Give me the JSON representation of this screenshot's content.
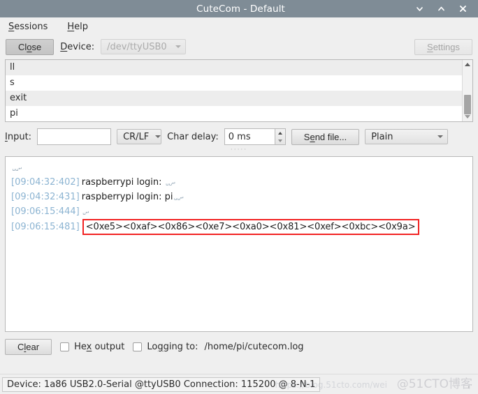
{
  "window": {
    "title": "CuteCom - Default",
    "buttons": {
      "minimize": "minimize-icon",
      "maximize": "maximize-icon",
      "close": "close-icon"
    },
    "titlebar_color": "#7f8c96"
  },
  "menubar": {
    "items": [
      {
        "label": "Sessions",
        "mnemonic_index": 1
      },
      {
        "label": "Help",
        "mnemonic_index": 0
      }
    ]
  },
  "toolbar": {
    "close_button": "Close",
    "device_label": "Device:",
    "device_value": "/dev/ttyUSB0",
    "device_enabled": false,
    "settings_button": "Settings",
    "settings_enabled": false
  },
  "history": {
    "rows": [
      "ll",
      "s",
      "exit",
      "pi"
    ],
    "scroll_thumb_position": "lower"
  },
  "input_row": {
    "input_label": "Input:",
    "input_value": "",
    "input_placeholder": "",
    "line_end_value": "CR/LF",
    "char_delay_label": "Char delay:",
    "char_delay_value": "0 ms",
    "send_file_button": "Send file...",
    "format_value": "Plain"
  },
  "terminal": {
    "lines": [
      {
        "timestamp": "",
        "text": "",
        "ctrl": "␣␣↵",
        "highlight": false
      },
      {
        "timestamp": "[09:04:32:402]",
        "text": "raspberrypi login: ",
        "ctrl": "␣␣↵",
        "highlight": false
      },
      {
        "timestamp": "[09:04:32:431]",
        "text": "raspberrypi login: pi",
        "ctrl": "␣␣↵",
        "highlight": false
      },
      {
        "timestamp": "[09:06:15:444]",
        "text": "",
        "ctrl": "␣↵",
        "highlight": false
      },
      {
        "timestamp": "[09:06:15:481]",
        "text": "<0xe5><0xaf><0x86><0xe7><0xa0><0x81><0xef><0xbc><0x9a>",
        "ctrl": "",
        "highlight": true
      }
    ],
    "timestamp_color": "#8cb4d2",
    "highlight_color": "#f22222"
  },
  "bottom": {
    "clear_button": "Clear",
    "hex_output_label": "Hex output",
    "hex_output_checked": false,
    "logging_label": "Logging to:",
    "logging_checked": false,
    "log_path": "/home/pi/cutecom.log"
  },
  "statusbar": {
    "text": "Device: 1a86 USB2.0-Serial @ttyUSB0 Connection: 115200 @ 8-N-1",
    "watermark": "@51CTO博客",
    "watermark_url": "https://blog.51cto.com/wei"
  }
}
